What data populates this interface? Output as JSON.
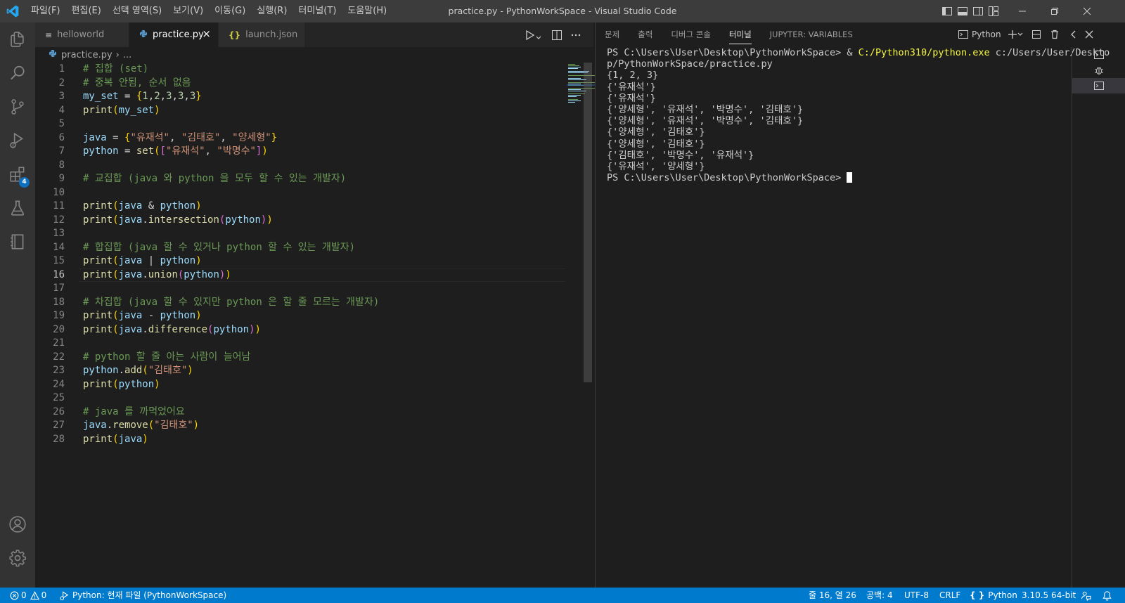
{
  "menu": [
    "파일(F)",
    "편집(E)",
    "선택 영역(S)",
    "보기(V)",
    "이동(G)",
    "실행(R)",
    "터미널(T)",
    "도움말(H)"
  ],
  "window_title": "practice.py - PythonWorkSpace - Visual Studio Code",
  "activity_bar": {
    "items": [
      "explorer-icon",
      "search-icon",
      "source-control-icon",
      "run-debug-icon",
      "extensions-icon",
      "testing-icon",
      "notebook-icon",
      "accounts-icon",
      "settings-gear-icon"
    ],
    "extensions_badge": "4"
  },
  "tabs": [
    {
      "label": "helloworld",
      "icon": "≡",
      "active": false
    },
    {
      "label": "practice.py",
      "icon": "python-icon",
      "active": true
    },
    {
      "label": "launch.json",
      "icon": "{}",
      "active": false
    }
  ],
  "breadcrumb": {
    "file": "practice.py",
    "more": "..."
  },
  "editor": {
    "current_line": 16,
    "line_numbers": [
      "1",
      "2",
      "3",
      "4",
      "5",
      "6",
      "7",
      "8",
      "9",
      "10",
      "11",
      "12",
      "13",
      "14",
      "15",
      "16",
      "17",
      "18",
      "19",
      "20",
      "21",
      "22",
      "23",
      "24",
      "25",
      "26",
      "27",
      "28"
    ],
    "text": {
      "l1": "# 집합 (set)",
      "l2": "# 중복 안됨, 순서 없음",
      "l9": "# 교집합 (java 와 python 을 모두 할 수 있는 개발자)",
      "l14": "# 합집합 (java 할 수 있거나 python 할 수 있는 개발자)",
      "l18": "# 차집합 (java 할 수 있지만 python 은 할 줄 모르는 개발자)",
      "l22": "# python 할 줄 아는 사람이 늘어남",
      "l26": "# java 를 까먹었어요",
      "my_set": "my_set",
      "java": "java",
      "python": "python",
      "print": "print",
      "set": "set",
      "intersection": "intersection",
      "union": "union",
      "difference": "difference",
      "add": "add",
      "remove": "remove",
      "nums": [
        "1",
        "2",
        "3",
        "3",
        "3"
      ],
      "s_yoo": "\"유재석\"",
      "s_kim": "\"김태호\"",
      "s_yang": "\"양세형\"",
      "s_park": "\"박명수\""
    }
  },
  "panel": {
    "tabs": [
      "문제",
      "출력",
      "디버그 콘솔",
      "터미널",
      "JUPYTER: VARIABLES"
    ],
    "active_tab": "터미널",
    "terminal_profile": "Python",
    "terminal": {
      "prompt": "PS C:\\Users\\User\\Desktop\\PythonWorkSpace> ",
      "amp": "& ",
      "exe": "C:/Python310/python.exe",
      "cmd_rest": " c:/Users/User/Deskto",
      "cmd_wrap": "p/PythonWorkSpace/practice.py",
      "output": [
        "{1, 2, 3}",
        "{'유재석'}",
        "{'유재석'}",
        "{'양세형', '유재석', '박명수', '김태호'}",
        "{'양세형', '유재석', '박명수', '김태호'}",
        "{'양세형', '김태호'}",
        "{'양세형', '김태호'}",
        "{'김태호', '박명수', '유재석'}",
        "{'유재석', '양세형'}"
      ],
      "final_prompt": "PS C:\\Users\\User\\Desktop\\PythonWorkSpace> "
    }
  },
  "status": {
    "errors": "0",
    "warnings": "0",
    "debug_config": "Python: 현재 파일 (PythonWorkSpace)",
    "position": "줄 16, 열 26",
    "indent": "공백: 4",
    "encoding": "UTF-8",
    "eol": "CRLF",
    "language": "Python",
    "interpreter": "3.10.5 64-bit"
  },
  "colors": {
    "accent": "#007acc",
    "titlebar": "#3c3c3c",
    "activity_bar": "#333333",
    "editor_bg": "#1e1e1e",
    "comment": "#6a9955",
    "variable": "#9cdcfe",
    "function": "#dcdcaa",
    "string": "#ce9178",
    "number": "#b5cea8"
  }
}
